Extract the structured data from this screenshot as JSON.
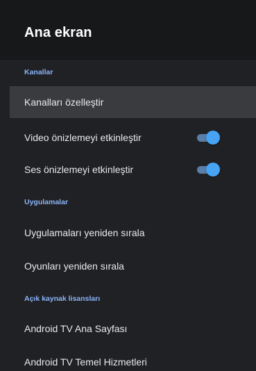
{
  "header": {
    "title": "Ana ekran"
  },
  "sections": {
    "channels": "Kanallar",
    "apps": "Uygulamalar",
    "licenses": "Açık kaynak lisansları"
  },
  "items": {
    "customize_channels": "Kanalları özelleştir",
    "video_preview": "Video önizlemeyi etkinleştir",
    "audio_preview": "Ses önizlemeyi etkinleştir",
    "reorder_apps": "Uygulamaları yeniden sırala",
    "reorder_games": "Oyunları yeniden sırala",
    "tv_home": "Android TV Ana Sayfası",
    "tv_core_services": "Android TV Temel Hizmetleri"
  },
  "toggles": {
    "video_preview_on": true,
    "audio_preview_on": true
  },
  "colors": {
    "accent": "#8ab4f8",
    "toggle_thumb": "#47a3f3",
    "toggle_track": "#5a7fa8",
    "focused_row": "#3a3b3e",
    "background": "#202124",
    "header_background": "#17181a"
  }
}
